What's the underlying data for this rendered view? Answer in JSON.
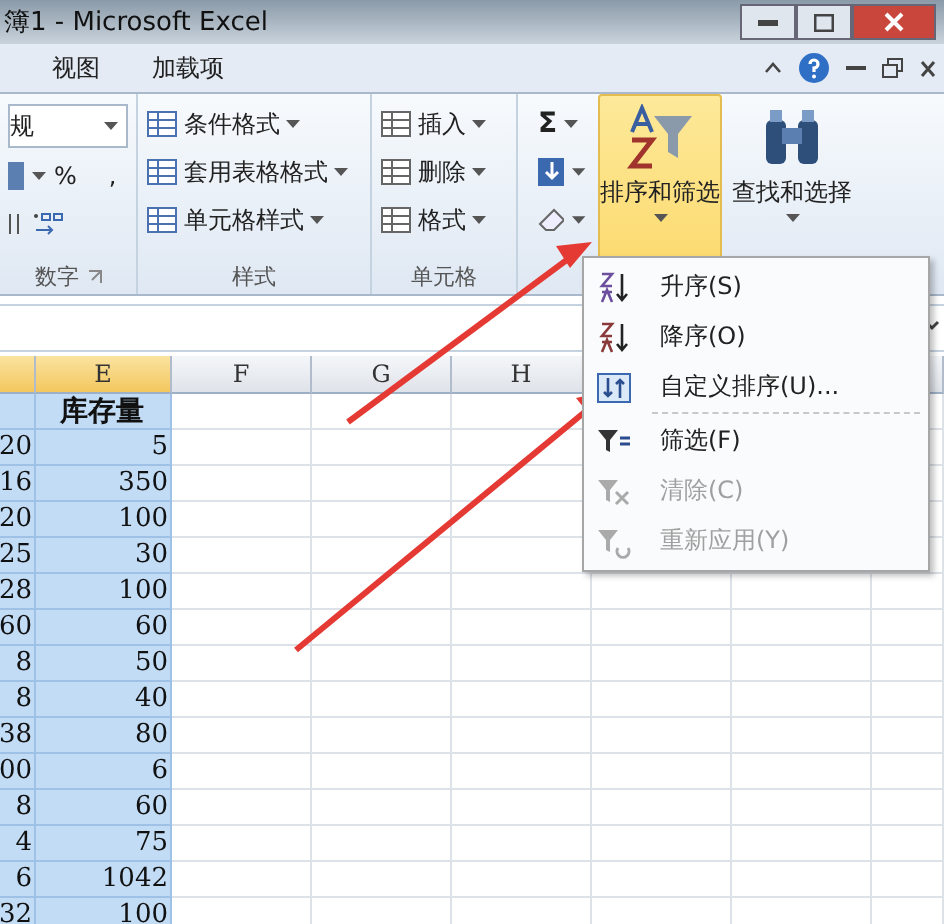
{
  "window": {
    "title": "簿1 - Microsoft Excel"
  },
  "tabs": [
    {
      "label": "视图"
    },
    {
      "label": "加载项"
    }
  ],
  "ribbon": {
    "number": {
      "format": "规",
      "percent": "%",
      "comma": ",",
      "label": "数字"
    },
    "styles": {
      "items": [
        "条件格式",
        "套用表格格式",
        "单元格样式"
      ],
      "label": "样式"
    },
    "cells": {
      "items": [
        "插入",
        "删除",
        "格式"
      ],
      "label": "单元格"
    },
    "editing": {
      "sigma": "Σ",
      "big_buttons": [
        {
          "label": "排序和筛选",
          "selected": true
        },
        {
          "label": "查找和选择",
          "selected": false
        }
      ]
    }
  },
  "sheet": {
    "columns": [
      {
        "selected": true
      },
      {
        "label": "E",
        "selected": true
      },
      {
        "label": "F",
        "selected": false
      },
      {
        "label": "G",
        "selected": false
      },
      {
        "label": "H",
        "selected": false
      }
    ],
    "rows": [
      [
        "",
        "库存量"
      ],
      [
        "20",
        "5"
      ],
      [
        "16",
        "350"
      ],
      [
        "20",
        "100"
      ],
      [
        "25",
        "30"
      ],
      [
        "28",
        "100"
      ],
      [
        "60",
        "60"
      ],
      [
        "8",
        "50"
      ],
      [
        "8",
        "40"
      ],
      [
        "38",
        "80"
      ],
      [
        "00",
        "6"
      ],
      [
        "8",
        "60"
      ],
      [
        "4",
        "75"
      ],
      [
        "6",
        "1042"
      ],
      [
        "32",
        "100"
      ]
    ]
  },
  "menu": {
    "items": [
      {
        "kind": "asc",
        "label": "升序(S)",
        "disabled": false
      },
      {
        "kind": "desc",
        "label": "降序(O)",
        "disabled": false
      },
      {
        "kind": "custom",
        "label": "自定义排序(U)...",
        "disabled": false
      },
      {
        "kind": "filter",
        "label": "筛选(F)",
        "disabled": false
      },
      {
        "kind": "clear",
        "label": "清除(C)",
        "disabled": true
      },
      {
        "kind": "reapply",
        "label": "重新应用(Y)",
        "disabled": true
      }
    ]
  }
}
